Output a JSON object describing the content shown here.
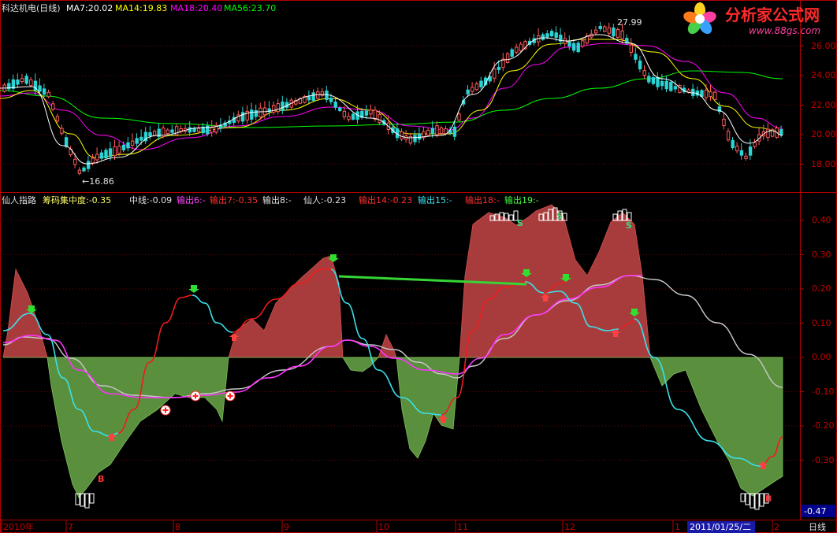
{
  "colors": {
    "frame": "#b00000",
    "axis_text": "#c80000",
    "zero_line": "#c00000",
    "red_area": "#a83c3c",
    "green_area": "#5a8f3d",
    "up_candle": "#ff5a5a",
    "down_candle": "#2ad4d4",
    "ma7": "#ffffff",
    "ma14": "#ffff00",
    "ma18": "#ff00ff",
    "ma56": "#00ff00",
    "cyan_line": "#38e2ee",
    "red_line": "#ee1c1c",
    "magenta_line": "#ff33ff",
    "grey_line": "#c8c8c8",
    "green_bar": "#35d635",
    "logo_red": "#ff2a2a",
    "logo_blue": "#3aa0ff"
  },
  "top_panel": {
    "legend": [
      {
        "text": "科达机电(日线)",
        "color": "#e0e0e0"
      },
      {
        "text": "MA7:20.02",
        "color": "#ffffff"
      },
      {
        "text": "MA14:19.83",
        "color": "#ffff00"
      },
      {
        "text": "MA18:20.40",
        "color": "#ff00ff"
      },
      {
        "text": "MA56:23.70",
        "color": "#00ff00"
      }
    ],
    "high_label": "27.99",
    "low_label": "←16.86",
    "y_ticks": [
      "26.00",
      "24.00",
      "22.00",
      "20.00",
      "18.00"
    ]
  },
  "bottom_panel": {
    "legend": [
      {
        "text": "仙人指路",
        "color": "#e0e0e0"
      },
      {
        "text": "筹码集中度:-0.35",
        "color": "#ffff66"
      },
      {
        "text": "中线:-0.09",
        "color": "#e0e0e0"
      },
      {
        "text": "输出6:-",
        "color": "#ff44ff"
      },
      {
        "text": "输出7:-0.35",
        "color": "#ff3030"
      },
      {
        "text": "输出8:-",
        "color": "#e0e0e0"
      },
      {
        "text": "仙人:-0.23",
        "color": "#e0e0e0"
      },
      {
        "text": "输出14:-0.23",
        "color": "#ff3030"
      },
      {
        "text": "输出15:-",
        "color": "#38e2ee"
      },
      {
        "text": "输出18:-",
        "color": "#ff3030"
      },
      {
        "text": "输出19:-",
        "color": "#40ff40"
      }
    ],
    "y_ticks": [
      "0.40",
      "0.30",
      "0.20",
      "0.10",
      "0.00",
      "-0.10",
      "-0.20",
      "-0.30"
    ],
    "current_value": "-0.47",
    "s_marker": "S",
    "b_marker": "B"
  },
  "x_axis": {
    "labels": [
      "2010年",
      "7",
      "8",
      "9",
      "10",
      "11",
      "12",
      "1",
      "2"
    ],
    "cursor_date": "2011/01/25/二",
    "period_label": "日线"
  },
  "logo": {
    "title": "分析家公式网",
    "url": "www.88gs.com"
  },
  "chart_data": [
    {
      "type": "candlestick",
      "title": "科达机电(日线)",
      "y_ticks": [
        18,
        20,
        22,
        24,
        26
      ],
      "ylim": [
        16.5,
        28.5
      ],
      "high": 27.99,
      "low": 16.86,
      "series": [
        {
          "name": "MA7",
          "value": 20.02
        },
        {
          "name": "MA14",
          "value": 19.83
        },
        {
          "name": "MA18",
          "value": 20.4
        },
        {
          "name": "MA56",
          "value": 23.7
        }
      ]
    },
    {
      "type": "area",
      "title": "仙人指路",
      "y_ticks": [
        0.4,
        0.3,
        0.2,
        0.1,
        0.0,
        -0.1,
        -0.2,
        -0.3
      ],
      "ylim": [
        -0.47,
        0.43
      ],
      "current_value": -0.47
    }
  ]
}
